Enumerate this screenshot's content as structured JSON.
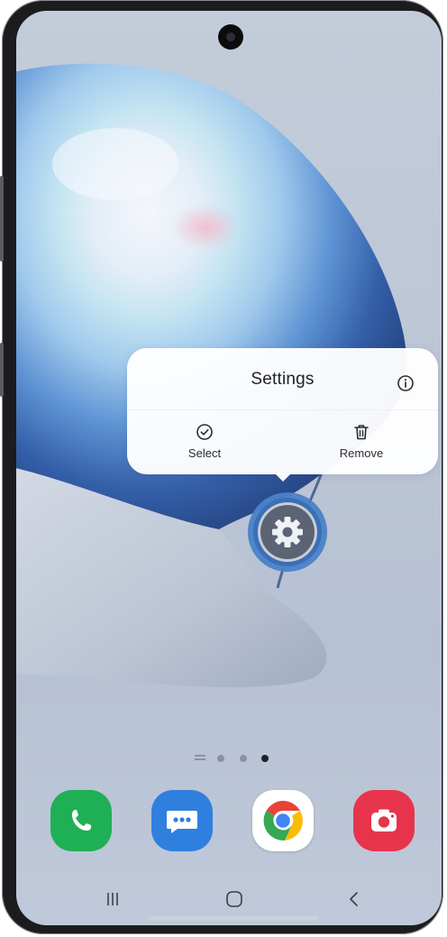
{
  "popup": {
    "title": "Settings",
    "info_icon": "info-icon",
    "actions": [
      {
        "label": "Select",
        "icon": "check-circle-icon"
      },
      {
        "label": "Remove",
        "icon": "trash-icon"
      }
    ]
  },
  "focused_app": {
    "icon": "settings-gear-icon",
    "color": "#5b6472"
  },
  "page_indicator": {
    "pages": 3,
    "active_index": 2
  },
  "dock": [
    {
      "name": "Phone",
      "icon": "phone-icon",
      "color": "#1fb055"
    },
    {
      "name": "Messages",
      "icon": "messages-icon",
      "color": "#2f7fde"
    },
    {
      "name": "Chrome",
      "icon": "chrome-icon",
      "color": "#ffffff"
    },
    {
      "name": "Camera",
      "icon": "camera-icon",
      "color": "#e8344a"
    }
  ],
  "navigation": [
    {
      "name": "recents",
      "icon": "recents-icon"
    },
    {
      "name": "home",
      "icon": "home-icon"
    },
    {
      "name": "back",
      "icon": "back-icon"
    }
  ],
  "colors": {
    "wallpaper_bg": "#bcc6d6",
    "ring_blue": "#4a82c8"
  }
}
